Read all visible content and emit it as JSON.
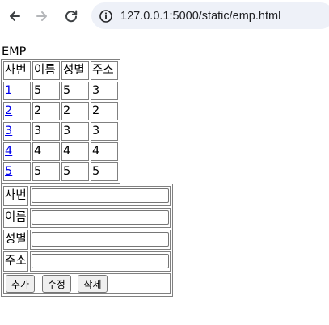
{
  "browser": {
    "url": "127.0.0.1:5000/static/emp.html",
    "icons": [
      "back-arrow-icon",
      "forward-arrow-icon",
      "reload-icon",
      "site-info-icon"
    ]
  },
  "page": {
    "title": "EMP",
    "table": {
      "headers": [
        "사번",
        "이름",
        "성별",
        "주소"
      ],
      "rows": [
        {
          "id": "1",
          "name": "5",
          "gender": "5",
          "addr": "3"
        },
        {
          "id": "2",
          "name": "2",
          "gender": "2",
          "addr": "2"
        },
        {
          "id": "3",
          "name": "3",
          "gender": "3",
          "addr": "3"
        },
        {
          "id": "4",
          "name": "4",
          "gender": "4",
          "addr": "4"
        },
        {
          "id": "5",
          "name": "5",
          "gender": "5",
          "addr": "5"
        }
      ]
    },
    "form": {
      "labels": [
        "사번",
        "이름",
        "성별",
        "주소"
      ],
      "values": [
        "",
        "",
        "",
        ""
      ],
      "buttons": {
        "add": "추가",
        "edit": "수정",
        "delete": "삭제"
      }
    }
  }
}
